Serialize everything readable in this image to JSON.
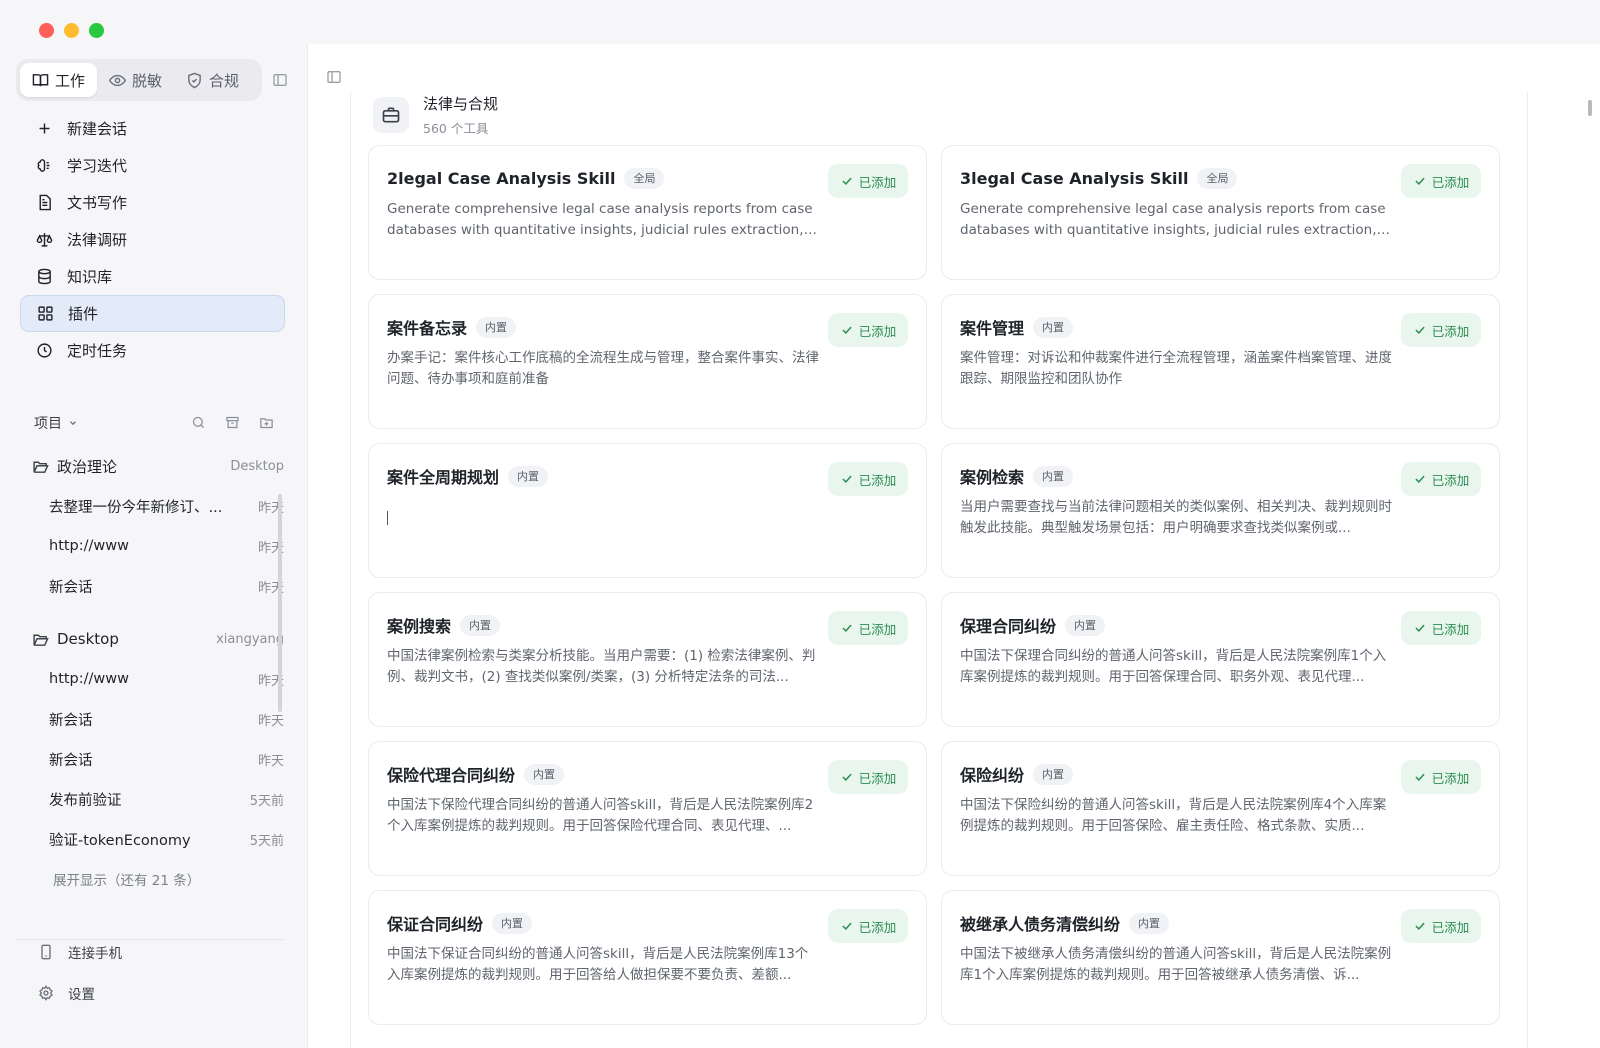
{
  "sidebar": {
    "mode_tabs": [
      {
        "label": "工作",
        "icon": "book-open-icon"
      },
      {
        "label": "脱敏",
        "icon": "eye-icon"
      },
      {
        "label": "合规",
        "icon": "shield-check-icon"
      }
    ],
    "nav": [
      {
        "label": "新建会话",
        "icon": "plus-icon"
      },
      {
        "label": "学习迭代",
        "icon": "brain-icon"
      },
      {
        "label": "文书写作",
        "icon": "document-icon"
      },
      {
        "label": "法律调研",
        "icon": "scale-icon"
      },
      {
        "label": "知识库",
        "icon": "database-icon"
      },
      {
        "label": "插件",
        "icon": "grid-icon"
      },
      {
        "label": "定时任务",
        "icon": "clock-icon"
      }
    ],
    "projects_label": "项目",
    "groups": [
      {
        "name": "政治理论",
        "meta": "Desktop",
        "sessions": [
          {
            "title": "去整理一份今年新修订、...",
            "time": "昨天"
          },
          {
            "title": "http://www",
            "time": "昨天"
          },
          {
            "title": "新会话",
            "time": "昨天"
          }
        ]
      },
      {
        "name": "Desktop",
        "meta": "xiangyang",
        "sessions": [
          {
            "title": "http://www",
            "time": "昨天"
          },
          {
            "title": "新会话",
            "time": "昨天"
          },
          {
            "title": "新会话",
            "time": "昨天"
          },
          {
            "title": "发布前验证",
            "time": "5天前"
          },
          {
            "title": "验证-tokenEconomy",
            "time": "5天前"
          }
        ]
      }
    ],
    "expand_more": "展开显示（还有 21 条）",
    "connect_phone": "连接手机",
    "settings": "设置"
  },
  "main": {
    "category": {
      "title": "法律与合规",
      "count": "560 个工具",
      "icon": "briefcase-icon"
    },
    "added_label": "已添加",
    "cards": [
      {
        "title": "2legal Case Analysis Skill",
        "badge": "全局",
        "desc": "Generate comprehensive legal case analysis reports from case databases with quantitative insights, judicial rules extraction, a..."
      },
      {
        "title": "3legal Case Analysis Skill",
        "badge": "全局",
        "desc": "Generate comprehensive legal case analysis reports from case databases with quantitative insights, judicial rules extraction, a..."
      },
      {
        "title": "案件备忘录",
        "badge": "内置",
        "desc": "办案手记：案件核心工作底稿的全流程生成与管理，整合案件事实、法律问题、待办事项和庭前准备"
      },
      {
        "title": "案件管理",
        "badge": "内置",
        "desc": "案件管理：对诉讼和仲裁案件进行全流程管理，涵盖案件档案管理、进度跟踪、期限监控和团队协作"
      },
      {
        "title": "案件全周期规划",
        "badge": "内置",
        "desc": ""
      },
      {
        "title": "案例检索",
        "badge": "内置",
        "desc": "当用户需要查找与当前法律问题相关的类似案例、相关判决、裁判规则时触发此技能。典型触发场景包括：用户明确要求查找类似案例或..."
      },
      {
        "title": "案例搜索",
        "badge": "内置",
        "desc": "中国法律案例检索与类案分析技能。当用户需要：(1) 检索法律案例、判例、裁判文书，(2) 查找类似案例/类案，(3) 分析特定法条的司法..."
      },
      {
        "title": "保理合同纠纷",
        "badge": "内置",
        "desc": "中国法下保理合同纠纷的普通人问答skill，背后是人民法院案例库1个入库案例提炼的裁判规则。用于回答保理合同、职务外观、表见代理..."
      },
      {
        "title": "保险代理合同纠纷",
        "badge": "内置",
        "desc": "中国法下保险代理合同纠纷的普通人问答skill，背后是人民法院案例库2个入库案例提炼的裁判规则。用于回答保险代理合同、表见代理、..."
      },
      {
        "title": "保险纠纷",
        "badge": "内置",
        "desc": "中国法下保险纠纷的普通人问答skill，背后是人民法院案例库4个入库案例提炼的裁判规则。用于回答保险、雇主责任险、格式条款、实质..."
      },
      {
        "title": "保证合同纠纷",
        "badge": "内置",
        "desc": "中国法下保证合同纠纷的普通人问答skill，背后是人民法院案例库13个入库案例提炼的裁判规则。用于回答给人做担保要不要负责、差额..."
      },
      {
        "title": "被继承人债务清偿纠纷",
        "badge": "内置",
        "desc": "中国法下被继承人债务清偿纠纷的普通人问答skill，背后是人民法院案例库1个入库案例提炼的裁判规则。用于回答被继承人债务清偿、诉..."
      }
    ]
  },
  "colors": {
    "accent_green": "#2c8c52",
    "added_bg": "#e9f6ee",
    "active_nav_bg": "#e3eaf8"
  }
}
